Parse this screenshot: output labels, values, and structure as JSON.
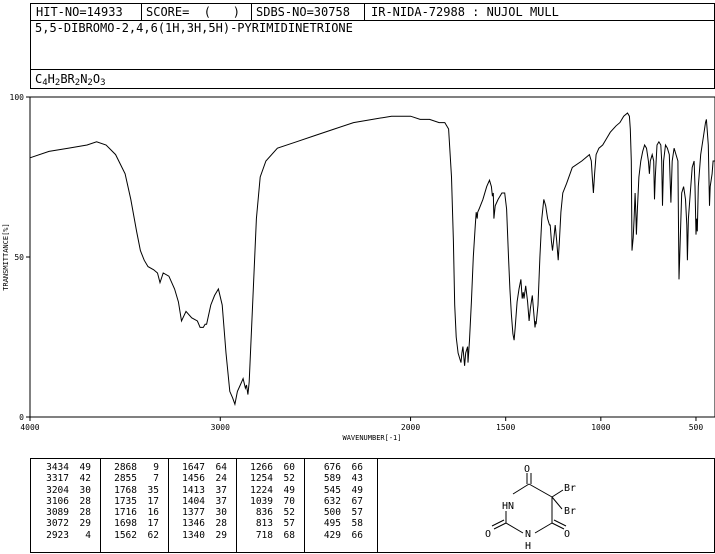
{
  "header": {
    "hit_no": "HIT-NO=14933",
    "score": "SCORE=  (   )",
    "sdbs_no": "SDBS-NO=30758",
    "ir_code": "IR-NIDA-72988 : NUJOL MULL",
    "compound_name": "5,5-DIBROMO-2,4,6(1H,3H,5H)-PYRIMIDINETRIONE",
    "formula": {
      "parts": [
        [
          "C",
          ""
        ],
        [
          "4",
          "sub"
        ],
        [
          "H",
          ""
        ],
        [
          "2",
          "sub"
        ],
        [
          "BR",
          ""
        ],
        [
          "2",
          "sub"
        ],
        [
          "N",
          ""
        ],
        [
          "2",
          "sub"
        ],
        [
          "O",
          ""
        ],
        [
          "3",
          "sub"
        ]
      ]
    }
  },
  "chart_data": {
    "type": "line",
    "xlabel": "WAVENUMBER[-1]",
    "ylabel": "TRANSMITTANCE[%]",
    "xlim": [
      4000,
      400
    ],
    "ylim": [
      0,
      100
    ],
    "xticks": [
      4000,
      3000,
      2000,
      1500,
      1000,
      500
    ],
    "yticks": [
      0,
      50,
      100
    ],
    "series": [
      {
        "points": [
          [
            4000,
            81
          ],
          [
            3900,
            83
          ],
          [
            3800,
            84
          ],
          [
            3700,
            85
          ],
          [
            3650,
            86
          ],
          [
            3600,
            85
          ],
          [
            3550,
            82
          ],
          [
            3500,
            76
          ],
          [
            3470,
            68
          ],
          [
            3440,
            58
          ],
          [
            3420,
            52
          ],
          [
            3400,
            49
          ],
          [
            3380,
            47
          ],
          [
            3350,
            46
          ],
          [
            3330,
            45
          ],
          [
            3317,
            42
          ],
          [
            3300,
            45
          ],
          [
            3270,
            44
          ],
          [
            3240,
            40
          ],
          [
            3220,
            36
          ],
          [
            3204,
            30
          ],
          [
            3180,
            33
          ],
          [
            3150,
            31
          ],
          [
            3120,
            30
          ],
          [
            3106,
            28
          ],
          [
            3095,
            28
          ],
          [
            3089,
            28
          ],
          [
            3080,
            29
          ],
          [
            3072,
            29
          ],
          [
            3050,
            35
          ],
          [
            3030,
            38
          ],
          [
            3010,
            40
          ],
          [
            2990,
            35
          ],
          [
            2970,
            20
          ],
          [
            2950,
            8
          ],
          [
            2935,
            6
          ],
          [
            2923,
            4
          ],
          [
            2910,
            8
          ],
          [
            2895,
            10
          ],
          [
            2880,
            12
          ],
          [
            2868,
            9
          ],
          [
            2862,
            10
          ],
          [
            2855,
            7
          ],
          [
            2848,
            11
          ],
          [
            2830,
            35
          ],
          [
            2810,
            62
          ],
          [
            2790,
            75
          ],
          [
            2760,
            80
          ],
          [
            2700,
            84
          ],
          [
            2600,
            86
          ],
          [
            2500,
            88
          ],
          [
            2400,
            90
          ],
          [
            2300,
            92
          ],
          [
            2200,
            93
          ],
          [
            2100,
            94
          ],
          [
            2050,
            94
          ],
          [
            2000,
            94
          ],
          [
            1950,
            93
          ],
          [
            1900,
            93
          ],
          [
            1850,
            92
          ],
          [
            1820,
            92
          ],
          [
            1800,
            90
          ],
          [
            1785,
            75
          ],
          [
            1775,
            55
          ],
          [
            1768,
            35
          ],
          [
            1760,
            25
          ],
          [
            1750,
            20
          ],
          [
            1740,
            18
          ],
          [
            1735,
            17
          ],
          [
            1730,
            20
          ],
          [
            1725,
            22
          ],
          [
            1716,
            16
          ],
          [
            1710,
            20
          ],
          [
            1700,
            22
          ],
          [
            1698,
            17
          ],
          [
            1690,
            24
          ],
          [
            1680,
            36
          ],
          [
            1670,
            50
          ],
          [
            1660,
            60
          ],
          [
            1655,
            64
          ],
          [
            1650,
            62
          ],
          [
            1647,
            64
          ],
          [
            1640,
            65
          ],
          [
            1620,
            68
          ],
          [
            1600,
            72
          ],
          [
            1585,
            74
          ],
          [
            1575,
            72
          ],
          [
            1570,
            69
          ],
          [
            1565,
            70
          ],
          [
            1562,
            62
          ],
          [
            1555,
            66
          ],
          [
            1540,
            68
          ],
          [
            1520,
            70
          ],
          [
            1505,
            70
          ],
          [
            1495,
            65
          ],
          [
            1485,
            50
          ],
          [
            1478,
            40
          ],
          [
            1470,
            32
          ],
          [
            1462,
            26
          ],
          [
            1456,
            24
          ],
          [
            1450,
            28
          ],
          [
            1440,
            36
          ],
          [
            1430,
            40
          ],
          [
            1420,
            43
          ],
          [
            1413,
            37
          ],
          [
            1408,
            39
          ],
          [
            1404,
            37
          ],
          [
            1395,
            41
          ],
          [
            1385,
            36
          ],
          [
            1377,
            30
          ],
          [
            1370,
            34
          ],
          [
            1360,
            38
          ],
          [
            1346,
            28
          ],
          [
            1342,
            30
          ],
          [
            1340,
            29
          ],
          [
            1330,
            35
          ],
          [
            1320,
            50
          ],
          [
            1310,
            62
          ],
          [
            1300,
            68
          ],
          [
            1290,
            66
          ],
          [
            1280,
            62
          ],
          [
            1270,
            60
          ],
          [
            1266,
            60
          ],
          [
            1260,
            55
          ],
          [
            1254,
            52
          ],
          [
            1248,
            55
          ],
          [
            1240,
            60
          ],
          [
            1232,
            55
          ],
          [
            1224,
            49
          ],
          [
            1218,
            55
          ],
          [
            1210,
            64
          ],
          [
            1200,
            70
          ],
          [
            1180,
            73
          ],
          [
            1150,
            78
          ],
          [
            1100,
            80
          ],
          [
            1060,
            82
          ],
          [
            1050,
            80
          ],
          [
            1045,
            75
          ],
          [
            1039,
            70
          ],
          [
            1033,
            76
          ],
          [
            1025,
            82
          ],
          [
            1010,
            84
          ],
          [
            990,
            85
          ],
          [
            970,
            87
          ],
          [
            950,
            89
          ],
          [
            920,
            91
          ],
          [
            900,
            92
          ],
          [
            880,
            94
          ],
          [
            860,
            95
          ],
          [
            850,
            94
          ],
          [
            845,
            90
          ],
          [
            840,
            80
          ],
          [
            836,
            52
          ],
          [
            830,
            56
          ],
          [
            825,
            62
          ],
          [
            820,
            70
          ],
          [
            815,
            62
          ],
          [
            813,
            57
          ],
          [
            808,
            65
          ],
          [
            800,
            75
          ],
          [
            790,
            80
          ],
          [
            780,
            83
          ],
          [
            770,
            85
          ],
          [
            760,
            84
          ],
          [
            750,
            80
          ],
          [
            745,
            76
          ],
          [
            740,
            80
          ],
          [
            730,
            82
          ],
          [
            722,
            80
          ],
          [
            718,
            68
          ],
          [
            714,
            75
          ],
          [
            705,
            85
          ],
          [
            695,
            86
          ],
          [
            685,
            85
          ],
          [
            680,
            80
          ],
          [
            676,
            66
          ],
          [
            670,
            80
          ],
          [
            660,
            85
          ],
          [
            650,
            84
          ],
          [
            640,
            82
          ],
          [
            632,
            67
          ],
          [
            625,
            80
          ],
          [
            615,
            84
          ],
          [
            605,
            82
          ],
          [
            595,
            80
          ],
          [
            589,
            43
          ],
          [
            583,
            55
          ],
          [
            575,
            70
          ],
          [
            565,
            72
          ],
          [
            555,
            68
          ],
          [
            548,
            60
          ],
          [
            545,
            49
          ],
          [
            540,
            62
          ],
          [
            530,
            70
          ],
          [
            520,
            78
          ],
          [
            510,
            80
          ],
          [
            505,
            72
          ],
          [
            500,
            57
          ],
          [
            496,
            62
          ],
          [
            493,
            58
          ],
          [
            488,
            72
          ],
          [
            475,
            82
          ],
          [
            460,
            88
          ],
          [
            450,
            92
          ],
          [
            445,
            93
          ],
          [
            435,
            85
          ],
          [
            429,
            66
          ],
          [
            425,
            72
          ],
          [
            415,
            76
          ],
          [
            410,
            80
          ],
          [
            400,
            80
          ]
        ]
      }
    ]
  },
  "peak_table": [
    [
      [
        "3434",
        "49"
      ],
      [
        "3317",
        "42"
      ],
      [
        "3204",
        "30"
      ],
      [
        "3106",
        "28"
      ],
      [
        "3089",
        "28"
      ],
      [
        "3072",
        "29"
      ],
      [
        "2923",
        "4"
      ]
    ],
    [
      [
        "2868",
        "9"
      ],
      [
        "2855",
        "7"
      ],
      [
        "1768",
        "35"
      ],
      [
        "1735",
        "17"
      ],
      [
        "1716",
        "16"
      ],
      [
        "1698",
        "17"
      ],
      [
        "1562",
        "62"
      ]
    ],
    [
      [
        "1647",
        "64"
      ],
      [
        "1456",
        "24"
      ],
      [
        "1413",
        "37"
      ],
      [
        "1404",
        "37"
      ],
      [
        "1377",
        "30"
      ],
      [
        "1346",
        "28"
      ],
      [
        "1340",
        "29"
      ]
    ],
    [
      [
        "1266",
        "60"
      ],
      [
        "1254",
        "52"
      ],
      [
        "1224",
        "49"
      ],
      [
        "1039",
        "70"
      ],
      [
        "836",
        "52"
      ],
      [
        "813",
        "57"
      ],
      [
        "718",
        "68"
      ]
    ],
    [
      [
        "676",
        "66"
      ],
      [
        "589",
        "43"
      ],
      [
        "545",
        "49"
      ],
      [
        "632",
        "67"
      ],
      [
        "500",
        "57"
      ],
      [
        "495",
        "58"
      ],
      [
        "429",
        "66"
      ]
    ]
  ],
  "structure": {
    "atoms": [
      "O",
      "Br",
      "Br",
      "HN",
      "O",
      "N",
      "H",
      "O"
    ]
  }
}
